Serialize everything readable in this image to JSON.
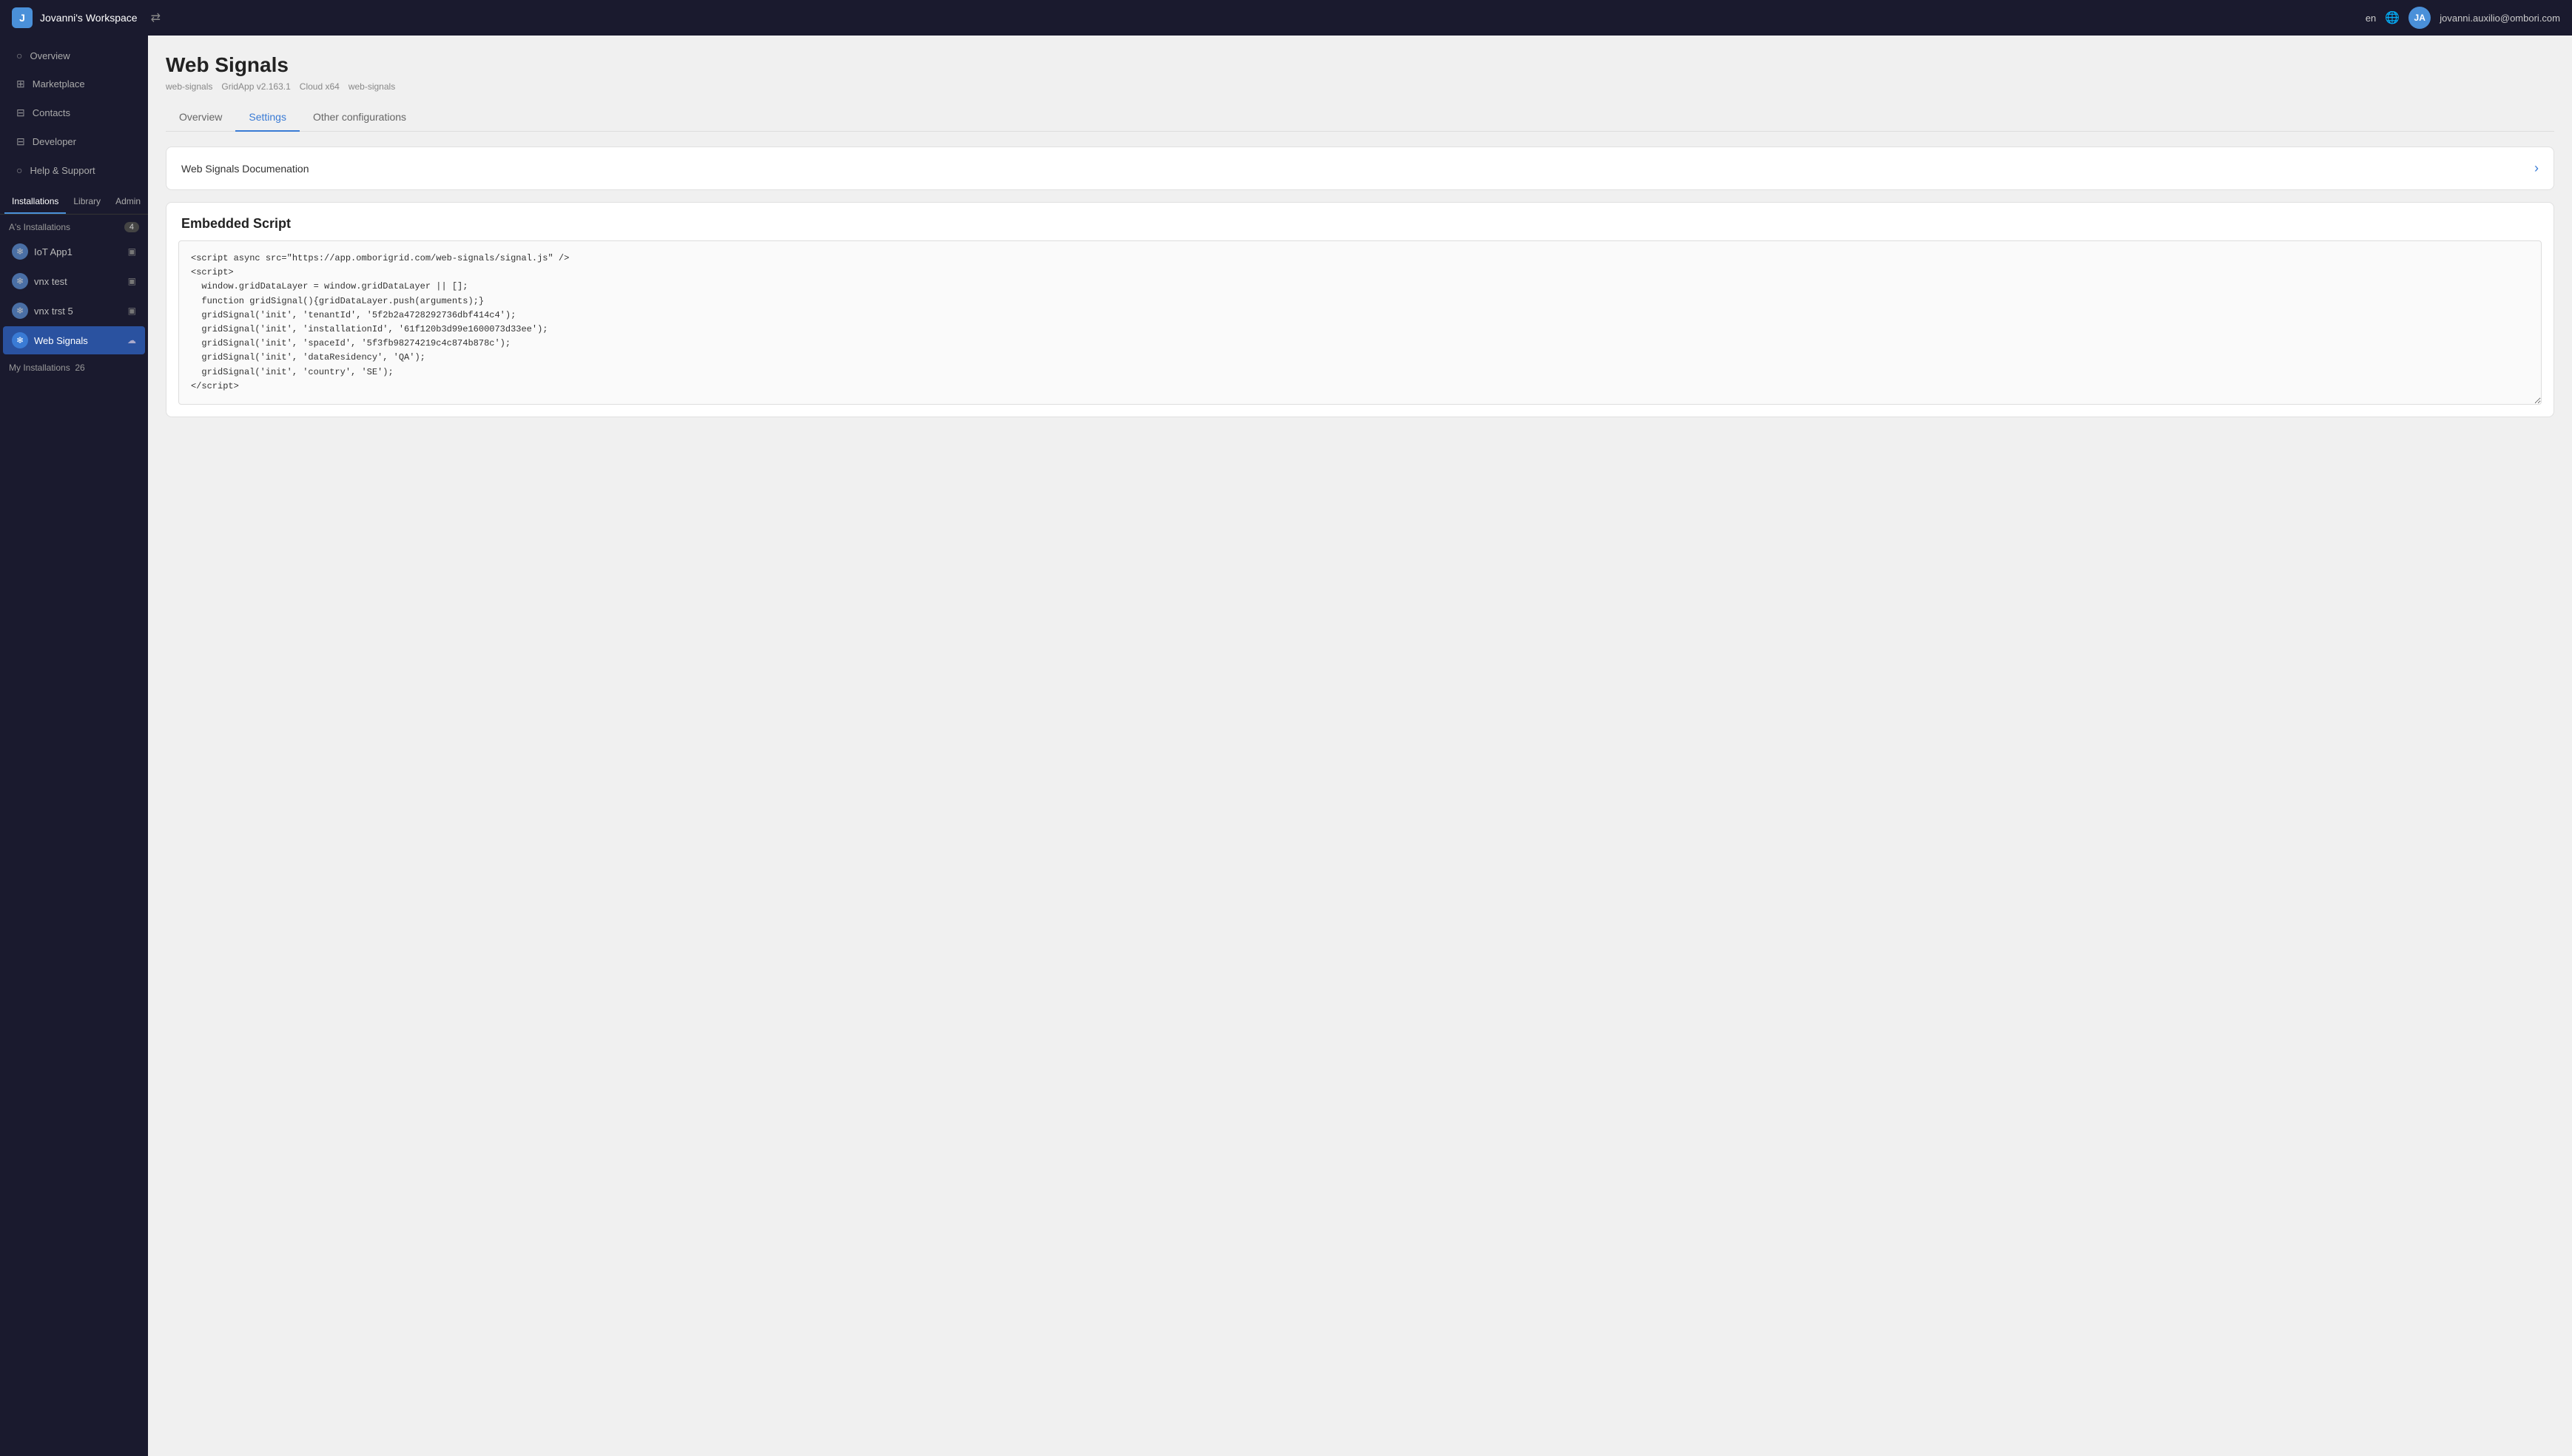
{
  "topbar": {
    "workspace_name": "Jovanni's Workspace",
    "swap_icon": "⇄",
    "lang": "en",
    "globe_icon": "🌐",
    "user_initials": "JA",
    "user_email": "jovanni.auxilio@ombori.com"
  },
  "sidebar": {
    "nav_items": [
      {
        "id": "overview",
        "label": "Overview",
        "icon": "○"
      },
      {
        "id": "marketplace",
        "label": "Marketplace",
        "icon": "⊞"
      },
      {
        "id": "contacts",
        "label": "Contacts",
        "icon": "⊟"
      },
      {
        "id": "developer",
        "label": "Developer",
        "icon": "⊟"
      },
      {
        "id": "help",
        "label": "Help & Support",
        "icon": "○"
      }
    ],
    "tabs": [
      {
        "id": "installations",
        "label": "Installations",
        "active": true
      },
      {
        "id": "library",
        "label": "Library",
        "active": false
      },
      {
        "id": "admin",
        "label": "Admin",
        "active": false
      }
    ],
    "installations_group": {
      "label": "A's Installations",
      "badge": "4",
      "items": [
        {
          "id": "iot-app1",
          "label": "IoT App1",
          "icon": "❄",
          "page_icon": "▣",
          "active": false
        },
        {
          "id": "vnx-test",
          "label": "vnx test",
          "icon": "❄",
          "page_icon": "▣",
          "active": false
        },
        {
          "id": "vnx-trst-5",
          "label": "vnx trst 5",
          "icon": "❄",
          "page_icon": "▣",
          "active": false
        },
        {
          "id": "web-signals",
          "label": "Web Signals",
          "icon": "❄",
          "page_icon": "☁",
          "active": true
        }
      ]
    },
    "my_installations": {
      "label": "My Installations",
      "badge": "26"
    }
  },
  "main": {
    "page_title": "Web Signals",
    "breadcrumbs": [
      "web-signals",
      "GridApp v2.163.1",
      "Cloud x64",
      "web-signals"
    ],
    "tabs": [
      {
        "id": "overview",
        "label": "Overview",
        "active": false
      },
      {
        "id": "settings",
        "label": "Settings",
        "active": true
      },
      {
        "id": "other-configurations",
        "label": "Other configurations",
        "active": false
      }
    ],
    "doc_section": {
      "label": "Web Signals Documenation",
      "chevron": "›"
    },
    "embedded_script": {
      "title": "Embedded Script",
      "code": "<script async src=\"https://app.omborigrid.com/web-signals/signal.js\" />\n<script>\n  window.gridDataLayer = window.gridDataLayer || [];\n  function gridSignal(){gridDataLayer.push(arguments);}\n  gridSignal('init', 'tenantId', '5f2b2a4728292736dbf414c4');\n  gridSignal('init', 'installationId', '61f120b3d99e1600073d33ee');\n  gridSignal('init', 'spaceId', '5f3fb98274219c4c874b878c');\n  gridSignal('init', 'dataResidency', 'QA');\n  gridSignal('init', 'country', 'SE');\n</script>"
    }
  }
}
